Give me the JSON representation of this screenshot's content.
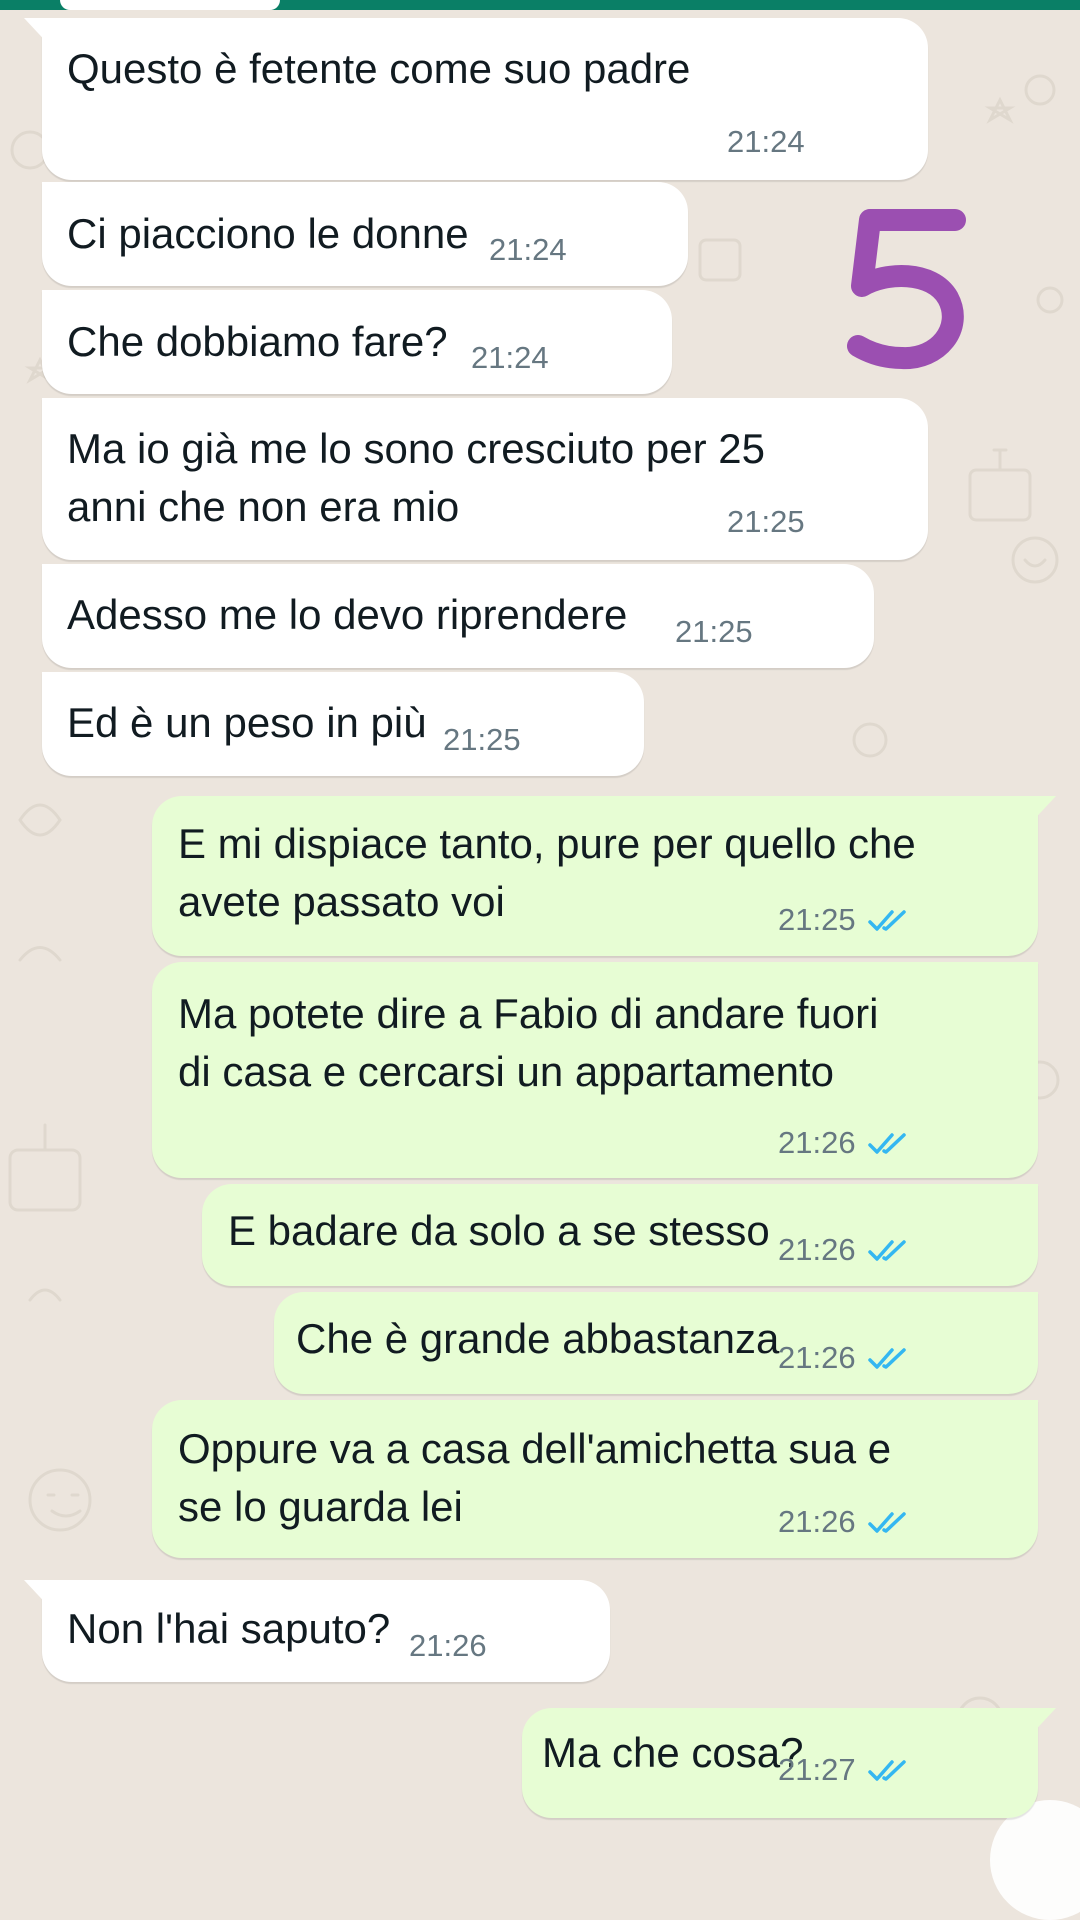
{
  "theme": {
    "accent": "#0a7f66",
    "incoming_bubble": "#ffffff",
    "outgoing_bubble": "#e7fdd4",
    "read_check": "#34b7f1",
    "annotation": "#9b4fb1"
  },
  "annotation": {
    "label": "5"
  },
  "messages": [
    {
      "direction": "in",
      "lines": [
        "Questo è fetente come suo padre"
      ],
      "time": "21:24"
    },
    {
      "direction": "in",
      "lines": [
        "Ci piacciono le donne"
      ],
      "time": "21:24"
    },
    {
      "direction": "in",
      "lines": [
        "Che dobbiamo fare?"
      ],
      "time": "21:24"
    },
    {
      "direction": "in",
      "lines": [
        "Ma io già me lo sono cresciuto per 25",
        "anni che non era mio"
      ],
      "time": "21:25"
    },
    {
      "direction": "in",
      "lines": [
        "Adesso me lo devo riprendere"
      ],
      "time": "21:25"
    },
    {
      "direction": "in",
      "lines": [
        "Ed è un peso in più"
      ],
      "time": "21:25"
    },
    {
      "direction": "out",
      "lines": [
        "E mi dispiace tanto, pure per quello che",
        "avete passato voi"
      ],
      "time": "21:25",
      "status": "read"
    },
    {
      "direction": "out",
      "lines": [
        "Ma potete dire a Fabio di andare fuori",
        "di casa e cercarsi un appartamento"
      ],
      "time": "21:26",
      "status": "read"
    },
    {
      "direction": "out",
      "lines": [
        "E badare da solo a se stesso"
      ],
      "time": "21:26",
      "status": "read"
    },
    {
      "direction": "out",
      "lines": [
        "Che è grande abbastanza"
      ],
      "time": "21:26",
      "status": "read"
    },
    {
      "direction": "out",
      "lines": [
        "Oppure va a casa dell'amichetta sua e",
        "se lo guarda lei"
      ],
      "time": "21:26",
      "status": "read"
    },
    {
      "direction": "in",
      "lines": [
        "Non l'hai saputo?"
      ],
      "time": "21:26"
    },
    {
      "direction": "out",
      "lines": [
        "Ma che cosa?"
      ],
      "time": "21:27",
      "status": "read"
    }
  ]
}
